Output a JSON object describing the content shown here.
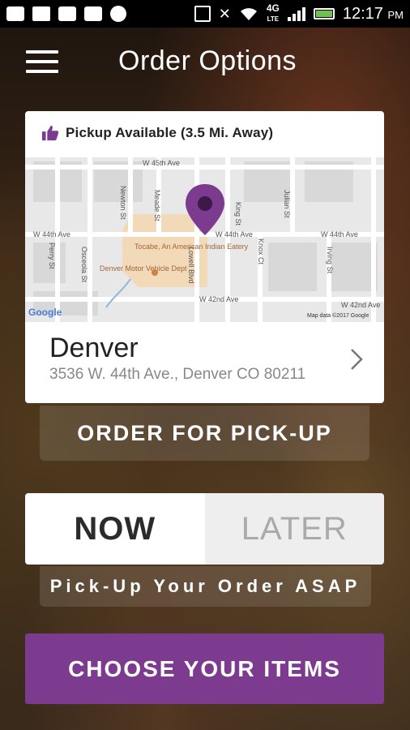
{
  "status_bar": {
    "time": "12:17",
    "ampm": "PM",
    "network": "4G",
    "network_sub": "LTE",
    "icons": [
      "add-icon",
      "mail-icon",
      "code-icon",
      "code-icon",
      "chat-icon",
      "nfc-icon",
      "mute-icon",
      "wifi-icon",
      "signal-icon",
      "battery-icon"
    ]
  },
  "header": {
    "title": "Order Options",
    "menu_icon": "hamburger-menu-icon"
  },
  "location_card": {
    "pickup_label": "Pickup Available (3.5 Mi. Away)",
    "name": "Denver",
    "address": "3536 W. 44th Ave., Denver CO 80211",
    "map": {
      "streets": [
        "W 45th Ave",
        "W 44th Ave",
        "W 44th Ave",
        "W 44th Ave",
        "W 42nd Ave",
        "W 42nd Ave",
        "Newton St",
        "Meade St",
        "King St",
        "Julian St",
        "Perry St",
        "Osceola St",
        "Lowell Blvd",
        "Knox Ct",
        "Irving St"
      ],
      "places": [
        "Tocabe, An American Indian Eatery",
        "Denver Motor Vehicle Dept"
      ],
      "google_logo": "Google",
      "attribution": "Map data ©2017 Google"
    },
    "accent_color": "#7c3b8f"
  },
  "order_pickup_button": "ORDER FOR PICK-UP",
  "timing_toggle": {
    "now": "NOW",
    "later": "LATER",
    "selected": "NOW"
  },
  "timing_caption": "Pick-Up Your Order ASAP",
  "choose_items_button": "CHOOSE YOUR ITEMS",
  "colors": {
    "brand_purple": "#7c3b8f",
    "card_bg": "#ffffff"
  }
}
